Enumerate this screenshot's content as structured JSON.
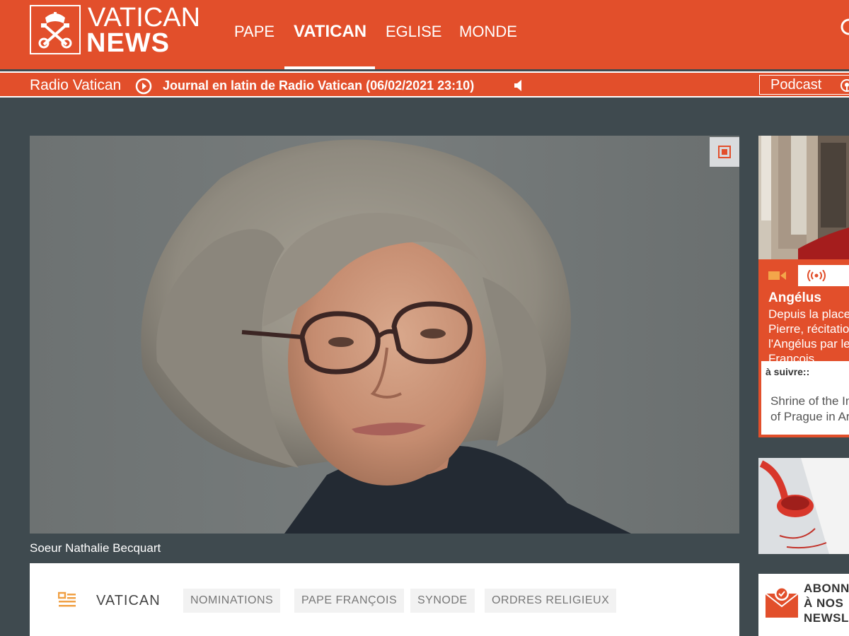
{
  "header": {
    "logo_line1": "VATICAN",
    "logo_line2": "NEWS",
    "nav": [
      {
        "label": "PAPE"
      },
      {
        "label": "VATICAN",
        "active": true
      },
      {
        "label": "EGLISE"
      },
      {
        "label": "MONDE"
      }
    ],
    "search_icon": "search-icon"
  },
  "radio": {
    "label": "Radio Vatican",
    "play_icon": "play-circle-icon",
    "journal": "Journal en latin de Radio Vatican (06/02/2021 23:10)",
    "speaker_icon": "speaker-icon",
    "podcast_label": "Podcast",
    "podcast_icon": "podcast-icon"
  },
  "hero": {
    "caption": "Soeur Nathalie Becquart",
    "expand_icon": "expand-icon"
  },
  "panel": {
    "section_icon": "news-list-icon",
    "title": "VATICAN",
    "tags": [
      "NOMINATIONS",
      "PAPE FRANÇOIS",
      "SYNODE",
      "ORDRES RELIGIEUX"
    ]
  },
  "sidebar": {
    "live": {
      "title": "Angélus",
      "description": "Depuis la place Saint-Pierre, récitation de l'Angélus par le Pape François",
      "next_label": "à suivre::",
      "next_text": "Shrine of the Infant Jesus of Prague in Arequipa"
    },
    "newsletter": {
      "line1": "ABONNEZ-VOUS",
      "line2": "À NOS",
      "line3": "NEWSLETTERS"
    }
  },
  "colors": {
    "brand_orange": "#e24f2b",
    "page_background": "#3f4a4f",
    "white": "#ffffff"
  }
}
